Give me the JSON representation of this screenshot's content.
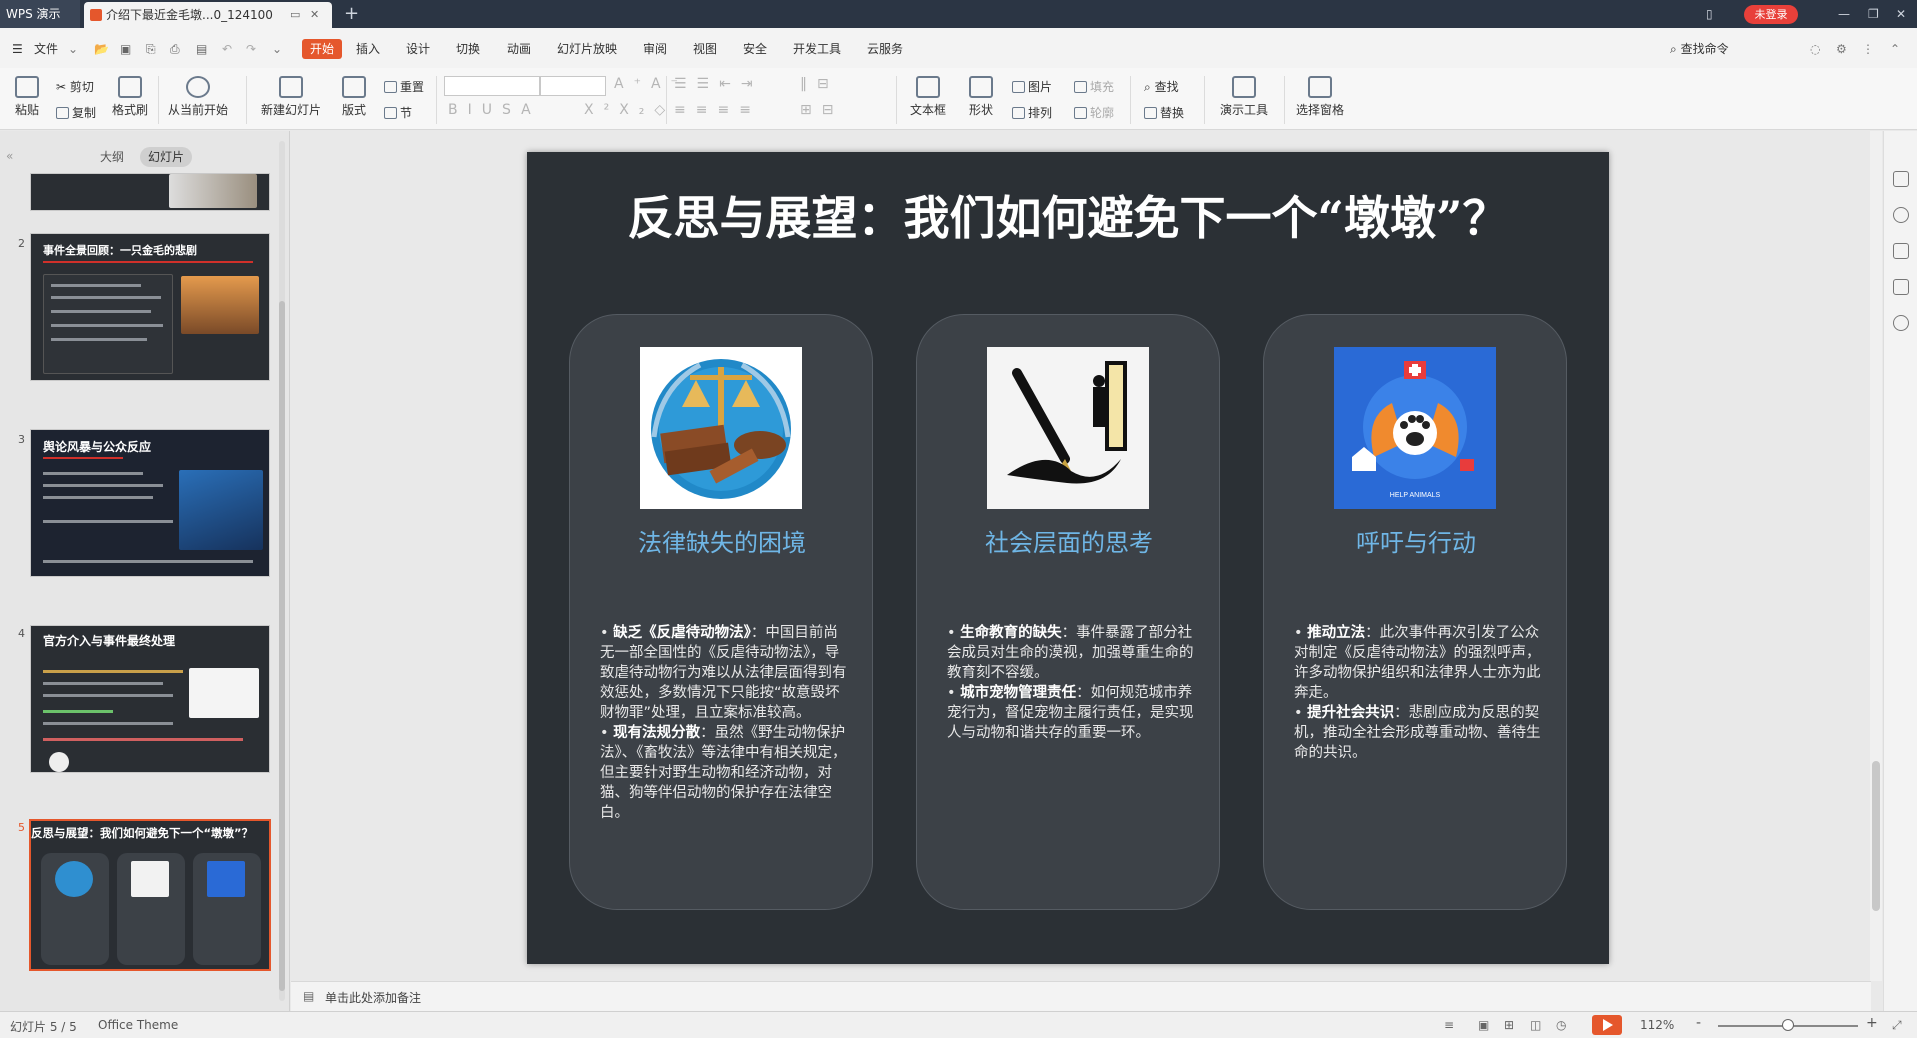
{
  "titlebar": {
    "app_name": "WPS 演示",
    "doc_tab": "介绍下最近金毛墩...0_124100",
    "add_tab": "+",
    "login": "未登录"
  },
  "menu": {
    "file": "文件",
    "tabs": [
      "开始",
      "插入",
      "设计",
      "切换",
      "动画",
      "幻灯片放映",
      "审阅",
      "视图",
      "安全",
      "开发工具",
      "云服务"
    ],
    "search": "查找命令"
  },
  "ribbon": {
    "paste": "粘贴",
    "cut": "剪切",
    "copy": "复制",
    "format_painter": "格式刷",
    "from_current": "从当前开始",
    "new_slide": "新建幻灯片",
    "layout": "版式",
    "reset": "重置",
    "section": "节",
    "text_box": "文本框",
    "shape": "形状",
    "picture": "图片",
    "fill": "填充",
    "arrange": "排列",
    "outline": "轮廓",
    "find": "查找",
    "replace": "替换",
    "presentation_tools": "演示工具",
    "selection_pane": "选择窗格"
  },
  "left_panel": {
    "tab_outline": "大纲",
    "tab_slides": "幻灯片",
    "thumbnails": [
      {
        "num": "2",
        "title": "事件全景回顾：一只金毛的悲剧"
      },
      {
        "num": "3",
        "title": "舆论风暴与公众反应"
      },
      {
        "num": "4",
        "title": "官方介入与事件最终处理"
      },
      {
        "num": "5",
        "title": "反思与展望：我们如何避免下一个“墩墩”？"
      }
    ]
  },
  "slide": {
    "title": "反思与展望：我们如何避免下一个“墩墩”？",
    "cards": [
      {
        "title": "法律缺失的困境",
        "items": [
          {
            "head": "缺乏《反虐待动物法》",
            "text": "：中国目前尚无一部全国性的《反虐待动物法》，导致虐待动物行为难以从法律层面得到有效惩处，多数情况下只能按“故意毁坏财物罪”处理，且立案标准较高。"
          },
          {
            "head": "现有法规分散",
            "text": "：虽然《野生动物保护法》、《畜牧法》等法律中有相关规定，但主要针对野生动物和经济动物，对猫、狗等伴侣动物的保护存在法律空白。"
          }
        ]
      },
      {
        "title": "社会层面的思考",
        "items": [
          {
            "head": "生命教育的缺失",
            "text": "：事件暴露了部分社会成员对生命的漠视，加强尊重生命的教育刻不容缓。"
          },
          {
            "head": "城市宠物管理责任",
            "text": "：如何规范城市养宠行为，督促宠物主履行责任，是实现人与动物和谐共存的重要一环。"
          }
        ]
      },
      {
        "title": "呼吁与行动",
        "image_caption": "HELP ANIMALS",
        "items": [
          {
            "head": "推动立法",
            "text": "：此次事件再次引发了公众对制定《反虐待动物法》的强烈呼声，许多动物保护组织和法律界人士亦为此奔走。"
          },
          {
            "head": "提升社会共识",
            "text": "：悲剧应成为反思的契机，推动全社会形成尊重动物、善待生命的共识。"
          }
        ]
      }
    ]
  },
  "notes": {
    "placeholder": "单击此处添加备注"
  },
  "status": {
    "slide_count": "幻灯片 5 / 5",
    "theme": "Office Theme",
    "zoom": "112%",
    "zoom_minus": "-",
    "zoom_plus": "+"
  },
  "colors": {
    "accent": "#e5572c",
    "slide_bg": "#2b3035",
    "card_title": "#6fb6e6"
  }
}
